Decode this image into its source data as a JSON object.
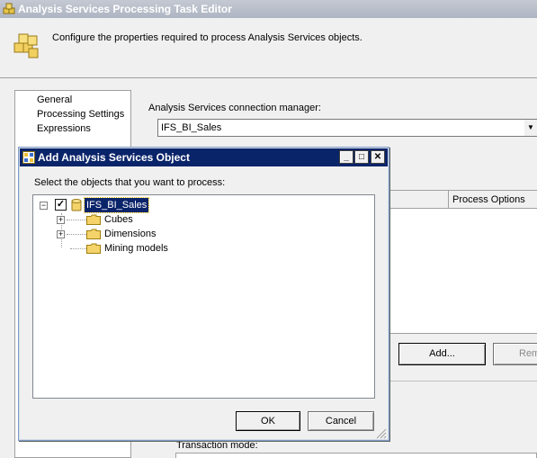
{
  "parent": {
    "title": "Analysis Services Processing Task Editor",
    "header_description": "Configure the properties required to process Analysis Services objects.",
    "nav": [
      "General",
      "Processing Settings",
      "Expressions"
    ],
    "connection_label": "Analysis Services connection manager:",
    "connection_value": "IFS_BI_Sales",
    "grid_column": "Process Options",
    "add_button": "Add...",
    "remove_button": "Rem",
    "transaction_label": "Transaction mode:"
  },
  "dialog": {
    "title": "Add Analysis Services Object",
    "prompt": "Select the objects that you want to process:",
    "tree": {
      "root": "IFS_BI_Sales",
      "children": [
        "Cubes",
        "Dimensions",
        "Mining models"
      ]
    },
    "ok": "OK",
    "cancel": "Cancel",
    "window_buttons": {
      "minimize": "_",
      "maximize": "□",
      "close": "✕"
    }
  },
  "colors": {
    "dialog_titlebar": "#0a246a",
    "parent_titlebar": "#aeb5c2",
    "selection": "#0a246a",
    "folder": "#f5d36b"
  },
  "icons": [
    "cube-stack-icon",
    "folder-icon",
    "database-icon",
    "checkbox-checked-icon",
    "expand-plus-icon",
    "collapse-minus-icon",
    "size-grip-icon"
  ]
}
